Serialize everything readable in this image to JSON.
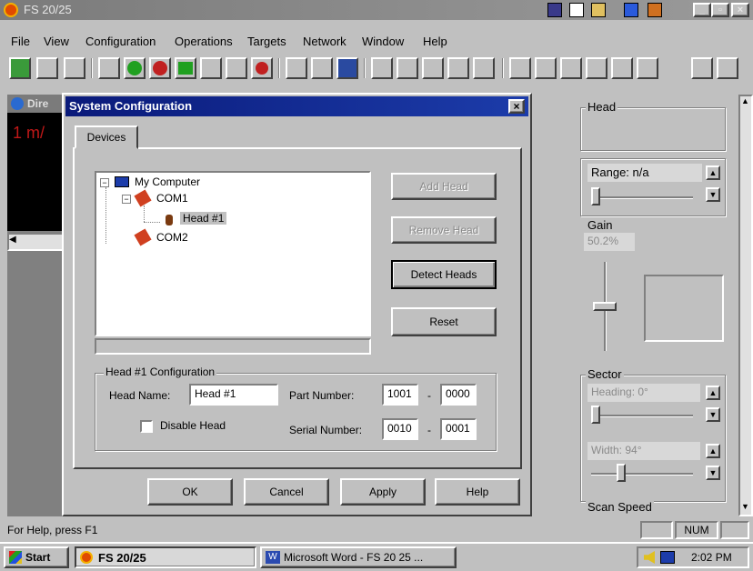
{
  "app": {
    "title": "FS 20/25",
    "window_controls": [
      "_",
      "▫",
      "×"
    ]
  },
  "menu": [
    "File",
    "View",
    "Configuration",
    "Operations",
    "Targets",
    "Network",
    "Window",
    "Help"
  ],
  "left_window": {
    "title": "Dire",
    "readout": "1 m/"
  },
  "dialog": {
    "title": "System Configuration",
    "close": "×",
    "tab": "Devices",
    "tree": {
      "root": "My Computer",
      "port1": "COM1",
      "head": "Head #1",
      "port2": "COM2"
    },
    "buttons": {
      "add_head": "Add Head",
      "remove_head": "Remove Head",
      "detect_heads": "Detect Heads",
      "reset": "Reset"
    },
    "config": {
      "group_label": "Head #1 Configuration",
      "head_name_label": "Head Name:",
      "head_name_value": "Head #1",
      "part_number_label": "Part Number:",
      "part_number_1": "1001",
      "part_number_2": "0000",
      "disable_label": "Disable Head",
      "serial_number_label": "Serial Number:",
      "serial_number_1": "0010",
      "serial_number_2": "0001",
      "dash": "-"
    },
    "footer": {
      "ok": "OK",
      "cancel": "Cancel",
      "apply": "Apply",
      "help": "Help"
    }
  },
  "right_panel": {
    "head_label": "Head",
    "range": "Range: n/a",
    "gain_label": "Gain",
    "gain_value": "50.2%",
    "sector_label": "Sector",
    "heading": "Heading: 0°",
    "width": "Width: 94°",
    "scan_speed_label": "Scan Speed"
  },
  "status": {
    "help_text": "For Help, press F1",
    "num": "NUM"
  },
  "taskbar": {
    "start": "Start",
    "task1": "FS 20/25",
    "task2": "Microsoft Word - FS 20 25 ...",
    "clock": "2:02 PM"
  },
  "colors": {
    "title_active": "#0a1a7a",
    "title_inactive": "#7b7b7b",
    "face": "#c0c0c0",
    "readout_red": "#c01818"
  }
}
